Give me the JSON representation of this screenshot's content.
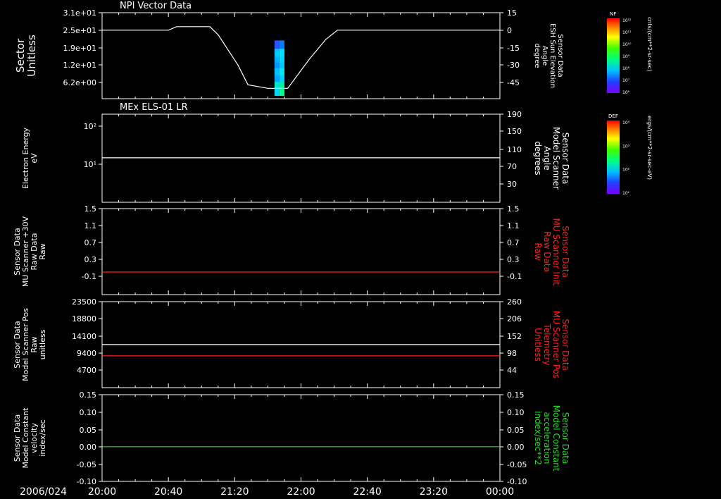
{
  "footer": {
    "date_label": "2006/024"
  },
  "x_axis": {
    "ticks": [
      "20:00",
      "20:40",
      "21:20",
      "22:00",
      "22:40",
      "23:20",
      "00:00"
    ],
    "range_minutes": [
      0,
      240
    ]
  },
  "colorbars": [
    {
      "title": "NF",
      "unit": "cnts/(cm**2-sr-sec)",
      "tick_labels": [
        "10¹²",
        "10¹¹",
        "10¹⁰",
        "10⁹",
        "10⁸",
        "10⁷",
        "10⁶"
      ]
    },
    {
      "title": "DEF",
      "unit": "ergs/(cm**2-sr-sec-eV)",
      "tick_labels": [
        "10⁴",
        "10³",
        "10²",
        "10¹"
      ]
    }
  ],
  "chart_data": [
    {
      "type": "heatmap",
      "panel_title": "NPI Vector Data",
      "ylabel": [
        "Sector",
        "Unitless"
      ],
      "y_ticks": [
        "3.1e+01",
        "2.5e+01",
        "1.9e+01",
        "1.2e+01",
        "6.2e+00"
      ],
      "heatmap_cells": [
        {
          "t": 104,
          "sector": 19.5,
          "color": "#2a55ff"
        },
        {
          "t": 107,
          "sector": 19.5,
          "color": "#0080ff"
        },
        {
          "t": 104,
          "sector": 16.5,
          "color": "#00c8ff"
        },
        {
          "t": 107,
          "sector": 16.5,
          "color": "#00e0ff"
        },
        {
          "t": 104,
          "sector": 13.5,
          "color": "#00b0ff"
        },
        {
          "t": 107,
          "sector": 13.5,
          "color": "#00d8ff"
        },
        {
          "t": 104,
          "sector": 11.5,
          "color": "#0098ff"
        },
        {
          "t": 107,
          "sector": 11.5,
          "color": "#00c8ff"
        },
        {
          "t": 104,
          "sector": 9.5,
          "color": "#00c0ff"
        },
        {
          "t": 107,
          "sector": 9.5,
          "color": "#00e8f0"
        },
        {
          "t": 104,
          "sector": 7,
          "color": "#00a8ff"
        },
        {
          "t": 107,
          "sector": 7,
          "color": "#00d0ff"
        },
        {
          "t": 104,
          "sector": 4.5,
          "color": "#00e8d0"
        },
        {
          "t": 107,
          "sector": 4.5,
          "color": "#00f0a0"
        },
        {
          "t": 104,
          "sector": 2.5,
          "color": "#00d8ff"
        },
        {
          "t": 107,
          "sector": 2.5,
          "color": "#00ff80"
        }
      ],
      "right_axis": {
        "label": [
          "Sensor Data",
          "ESH Sun Elevation",
          "Angle",
          "degree"
        ],
        "ticks": [
          "15",
          "0",
          "-15",
          "-30",
          "-45"
        ]
      },
      "series": [
        {
          "color": "#ffffff",
          "points": [
            [
              0,
              0
            ],
            [
              40,
              0
            ],
            [
              45,
              3
            ],
            [
              65,
              3
            ],
            [
              70,
              -4
            ],
            [
              82,
              -30
            ],
            [
              88,
              -47
            ],
            [
              100,
              -50
            ],
            [
              112,
              -50
            ],
            [
              125,
              -25
            ],
            [
              135,
              -8
            ],
            [
              142,
              0
            ],
            [
              240,
              0
            ]
          ]
        }
      ]
    },
    {
      "type": "line",
      "panel_title": "MEx ELS-01 LR",
      "ylabel": [
        "Electron Energy",
        "eV"
      ],
      "y_ticks": [
        "10²",
        "10¹"
      ],
      "right_axis": {
        "label": [
          "Sensor Data",
          "Model Scanner",
          "Angle",
          "degrees"
        ],
        "ticks": [
          "190",
          "150",
          "110",
          "70",
          "30"
        ]
      },
      "series": [
        {
          "color": "#ffffff",
          "values_const": 90
        }
      ]
    },
    {
      "type": "line",
      "ylabel": [
        "Sensor Data",
        "MU Scanner +30V",
        "Raw Data",
        "Raw"
      ],
      "y_ticks": [
        "1.5",
        "1.1",
        "0.7",
        "0.3",
        "-0.1"
      ],
      "right_axis": {
        "label": [
          "Sensor Data",
          "MU Scanner Init",
          "Raw Data",
          "Raw"
        ],
        "ticks": [
          "1.5",
          "1.1",
          "0.7",
          "0.3",
          "-0.1"
        ]
      },
      "series": [
        {
          "color": "#ff2020",
          "values_const": 0.0
        }
      ]
    },
    {
      "type": "line",
      "ylabel": [
        "Sensor Data",
        "Model Scanner Pos",
        "Raw",
        "unitless"
      ],
      "y_ticks": [
        "23500",
        "18800",
        "14100",
        "9400",
        "4700"
      ],
      "right_axis": {
        "label": [
          "Sensor Data",
          "MU Scanner Pos",
          "Telemetry",
          "Unitless"
        ],
        "ticks": [
          "260",
          "206",
          "152",
          "98",
          "44"
        ]
      },
      "series": [
        {
          "color": "#ffffff",
          "values_const": 11700
        },
        {
          "color": "#ff2020",
          "values_const": 8600
        }
      ]
    },
    {
      "type": "line",
      "ylabel": [
        "Sensor Data",
        "Model Constant",
        "velocity",
        "index/sec"
      ],
      "y_ticks": [
        "0.15",
        "0.10",
        "0.05",
        "0.00",
        "-0.05",
        "-0.10"
      ],
      "right_axis": {
        "label": [
          "Sensor Data",
          "Model Constant",
          "acceleration",
          "index/sec**2"
        ],
        "ticks": [
          "0.15",
          "0.10",
          "0.05",
          "0.00",
          "-0.05",
          "-0.10"
        ]
      },
      "series": [
        {
          "color": "#20e020",
          "values_const": 0.0
        }
      ]
    }
  ]
}
